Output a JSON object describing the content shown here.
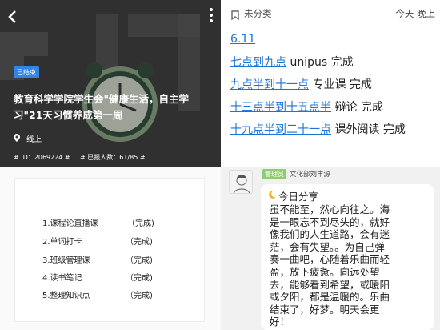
{
  "event": {
    "status": "已结束",
    "title": "教育科学学院学生会\"健康生活，自主学习\"21天习惯养成第一周",
    "location": "线上",
    "id_text": "# ID：2069224 #",
    "enrolled_text": "# 已报人数：61/85 #"
  },
  "checklist": {
    "tasks": [
      {
        "label": "1.课程论直播课",
        "status": "（完成)"
      },
      {
        "label": "2.单词打卡",
        "status": "（完成)"
      },
      {
        "label": "3.班级管理课",
        "status": "（完成)"
      },
      {
        "label": "4.读书笔记",
        "status": "（完成)"
      },
      {
        "label": "5.整理知识点",
        "status": "（完成)"
      }
    ]
  },
  "notes": {
    "category": "未分类",
    "time": "今天 晚上",
    "date": "6.11",
    "entries": [
      {
        "time_range": "七点到九点",
        "activity": " unipus 完成"
      },
      {
        "time_range": "九点半到十一点",
        "activity": " 专业课 完成"
      },
      {
        "time_range": "十三点半到十五点半",
        "activity": " 辩论 完成"
      },
      {
        "time_range": "十九点半到二十一点",
        "activity": " 课外阅读 完成"
      }
    ]
  },
  "chat": {
    "badge": "管理员",
    "sender": "文化部刘丰源",
    "heading": "今日分享",
    "lines": [
      "虽不能至，然心向往之。海",
      "是一眼忘不到尽头的，就好",
      "像我们的人生道路，会有迷",
      "茫，会有失望。。为自己弹",
      "奏一曲吧，心随着乐曲而轻",
      "盈，放下疲惫。向远处望",
      "去，能够看到希望，或暖阳",
      "或夕阳，都是温暖的。乐曲",
      "结束了，好梦。明天会更",
      "好！"
    ]
  },
  "colors": {
    "link": "#1e73d8",
    "badge": "#2d86e8",
    "admin": "#8fce6e"
  }
}
